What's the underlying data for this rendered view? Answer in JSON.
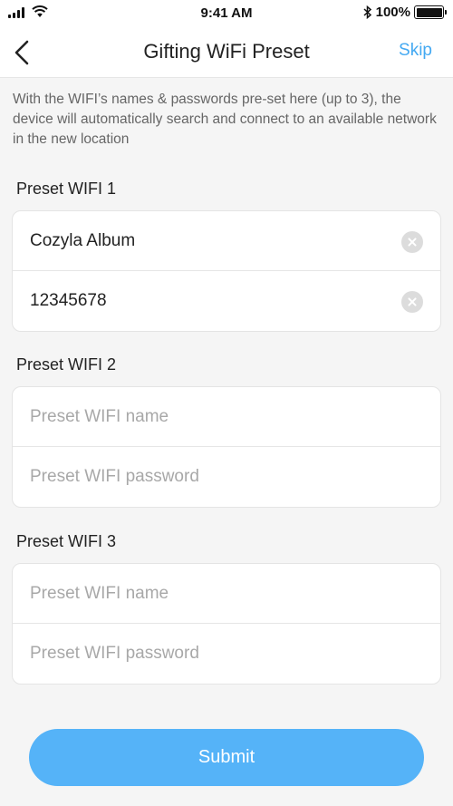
{
  "status_bar": {
    "time": "9:41 AM",
    "battery": "100%"
  },
  "nav": {
    "title": "Gifting WiFi Preset",
    "skip_label": "Skip"
  },
  "intro": "With the WIFI’s names & passwords pre-set here (up to 3), the device will automatically search and connect to an available network in the new location",
  "presets": [
    {
      "label": "Preset WIFI 1",
      "name_value": "Cozyla Album",
      "password_value": "12345678",
      "name_placeholder": "",
      "password_placeholder": ""
    },
    {
      "label": "Preset WIFI 2",
      "name_value": "",
      "password_value": "",
      "name_placeholder": "Preset WIFI name",
      "password_placeholder": "Preset WIFI password"
    },
    {
      "label": "Preset WIFI 3",
      "name_value": "",
      "password_value": "",
      "name_placeholder": "Preset WIFI name",
      "password_placeholder": "Preset WIFI password"
    }
  ],
  "submit_label": "Submit",
  "colors": {
    "accent": "#44a9f2",
    "submit_bg": "#55b3f8",
    "background": "#f5f5f5"
  }
}
